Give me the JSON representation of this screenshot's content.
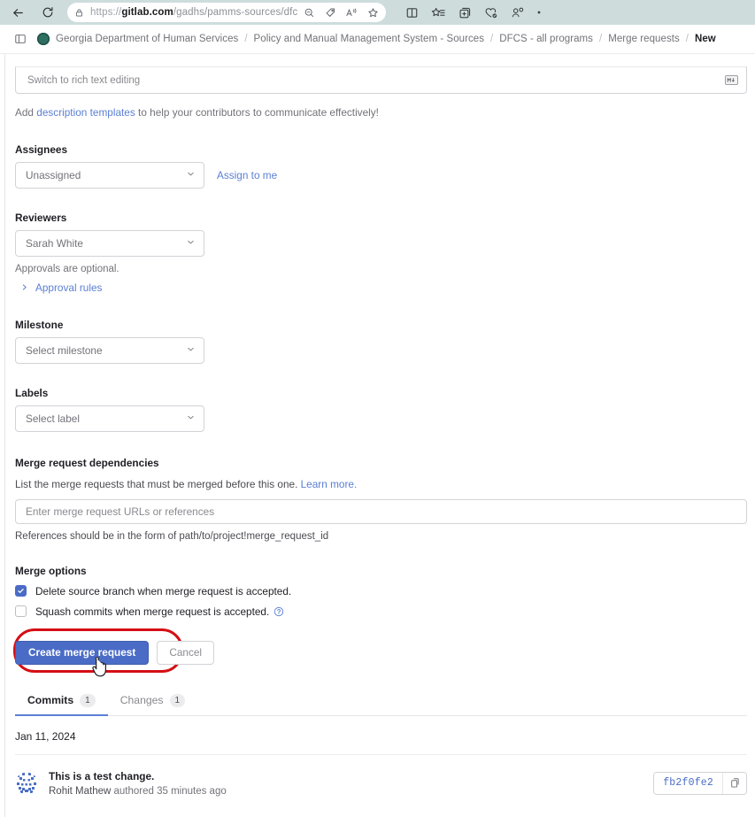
{
  "browser": {
    "back_icon": "back-arrow-icon",
    "reload_icon": "reload-icon",
    "url": "https://gitlab.com/gadhs/pamms-sources/dfcs/-/m...",
    "url_scheme": "https://",
    "url_host": "gitlab.com",
    "url_path": "/gadhs/pamms-sources/dfcs/-/m...",
    "lock_icon": "lock-icon",
    "omnibox_icons": [
      "zoom-out-icon",
      "shopping-tag-icon",
      "read-aloud-icon",
      "favorite-star-icon"
    ],
    "toolbar_icons": [
      "split-screen-icon",
      "collections-icon",
      "add-tab-group-icon",
      "browser-essentials-icon",
      "profile-icon",
      "more-options-icon"
    ]
  },
  "breadcrumb": {
    "sidebar_toggle_icon": "sidebar-toggle-icon",
    "group_avatar_icon": "group-avatar",
    "separator": "/",
    "items": [
      {
        "label": "Georgia Department of Human Services",
        "current": false
      },
      {
        "label": "Policy and Manual Management System - Sources",
        "current": false
      },
      {
        "label": "DFCS - all programs",
        "current": false
      },
      {
        "label": "Merge requests",
        "current": false
      },
      {
        "label": "New",
        "current": true
      }
    ]
  },
  "editor": {
    "switch_label": "Switch to rich text editing",
    "markdown_icon": "markdown-icon",
    "markdown_glyph": "M↓"
  },
  "description_help": {
    "prefix": "Add ",
    "link": "description templates",
    "suffix": " to help your contributors to communicate effectively!"
  },
  "assignees": {
    "label": "Assignees",
    "value": "Unassigned",
    "chevron_icon": "chevron-down-icon",
    "assign_link": "Assign to me"
  },
  "reviewers": {
    "label": "Reviewers",
    "value": "Sarah White",
    "chevron_icon": "chevron-down-icon",
    "note": "Approvals are optional.",
    "approval_rules_label": "Approval rules",
    "approval_rules_icon": "chevron-right-icon"
  },
  "milestone": {
    "label": "Milestone",
    "value": "Select milestone",
    "chevron_icon": "chevron-down-icon"
  },
  "labels": {
    "label": "Labels",
    "value": "Select label",
    "chevron_icon": "chevron-down-icon"
  },
  "dependencies": {
    "title": "Merge request dependencies",
    "desc_prefix": "List the merge requests that must be merged before this one. ",
    "desc_link": "Learn more.",
    "input_value": "",
    "input_placeholder": "Enter merge request URLs or references",
    "hint": "References should be in the form of path/to/project!merge_request_id"
  },
  "merge_options": {
    "title": "Merge options",
    "items": [
      {
        "label": "Delete source branch when merge request is accepted.",
        "checked": true,
        "has_help": false
      },
      {
        "label": "Squash commits when merge request is accepted.",
        "checked": false,
        "has_help": true,
        "help_icon": "question-circle-icon"
      }
    ]
  },
  "actions": {
    "submit_label": "Create merge request",
    "cancel_label": "Cancel",
    "highlight_color": "#d40f15",
    "submit_color": "#4a6cc7",
    "cursor_icon": "pointer-hand-cursor"
  },
  "tabs": [
    {
      "label": "Commits",
      "count": "1",
      "active": true
    },
    {
      "label": "Changes",
      "count": "1",
      "active": false
    }
  ],
  "commits": {
    "date_group": "Jan 11, 2024",
    "rows": [
      {
        "avatar_icon": "identicon-avatar",
        "title": "This is a test change.",
        "author": "Rohit Mathew",
        "meta_suffix": " authored 35 minutes ago",
        "sha": "fb2f0fe2",
        "copy_icon": "copy-to-clipboard-icon"
      }
    ]
  }
}
